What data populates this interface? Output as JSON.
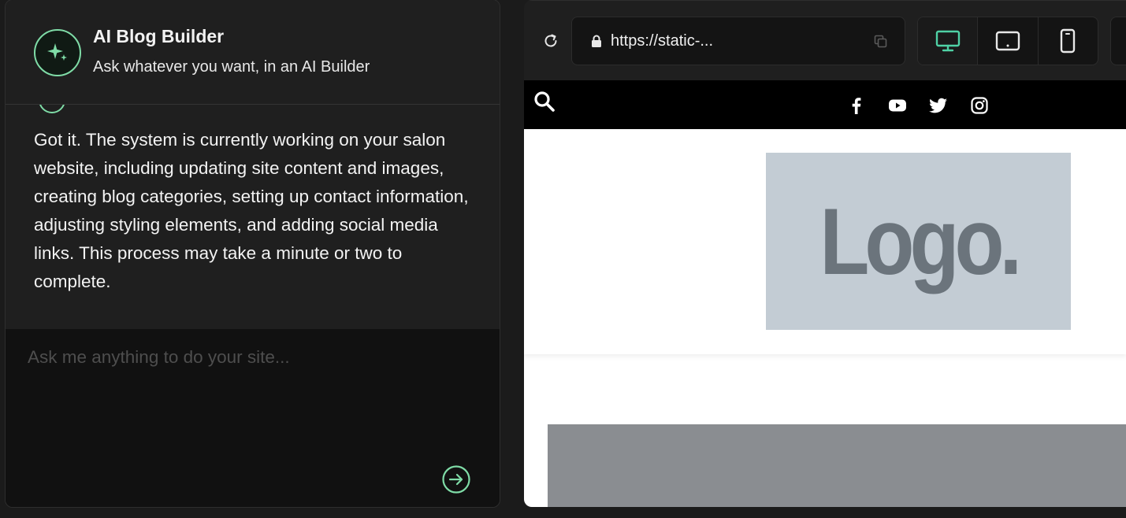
{
  "chat": {
    "title": "AI Blog Builder",
    "subtitle": "Ask whatever you want, in an AI Builder",
    "message": "Got it. The system is currently working on your salon website, including updating site content and images, creating blog categories, setting up contact information, adjusting styling elements, and adding social media links. This process may take a minute or two to complete.",
    "input_placeholder": "Ask me anything to do your site...",
    "input_value": "",
    "accent_color": "#7fdca7"
  },
  "preview": {
    "url": "https://static-...",
    "active_device": "desktop",
    "devices": [
      "desktop",
      "tablet",
      "mobile"
    ],
    "site": {
      "logo_text": "Logo.",
      "social_icons": [
        "facebook-icon",
        "youtube-icon",
        "twitter-icon",
        "instagram-icon"
      ]
    }
  }
}
